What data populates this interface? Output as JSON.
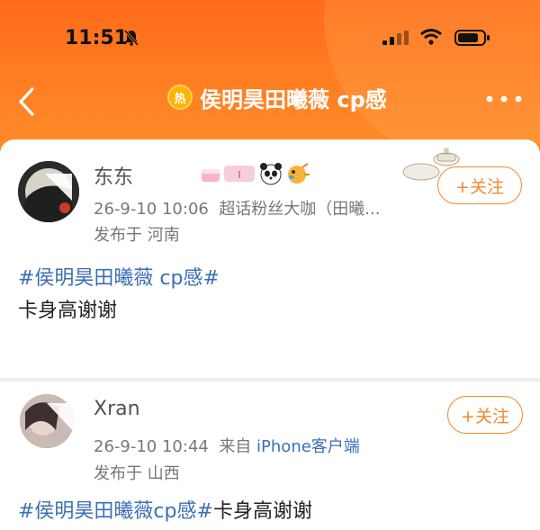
{
  "status_bar": {
    "time": "11:51"
  },
  "nav": {
    "hot_badge": "热",
    "title": "侯明昊田曦薇 cp感"
  },
  "posts": [
    {
      "username": "东东",
      "time": "26-9-10 10:06",
      "source": "超话粉丝大咖（田曦...",
      "location": "发布于 河南",
      "follow_label": "+关注",
      "hashtag": "#侯明昊田曦薇 cp感#",
      "text": "卡身高谢谢"
    },
    {
      "username": "Xran",
      "time": "26-9-10 10:44",
      "source_prefix": "来自",
      "source": "iPhone客户端",
      "location": "发布于 山西",
      "follow_label": "+关注",
      "hashtag": "#侯明昊田曦薇cp感#",
      "text": "卡身高谢谢"
    }
  ],
  "colors": {
    "header": "#ff7a1f",
    "accent": "#f28a2c",
    "link": "#3b6fb6"
  },
  "icons": [
    "bell-slash-icon",
    "signal-icon",
    "wifi-icon",
    "battery-icon",
    "back-arrow-icon",
    "more-icon",
    "panda-emoji",
    "pufferfish-emoji",
    "cake-emoji"
  ]
}
